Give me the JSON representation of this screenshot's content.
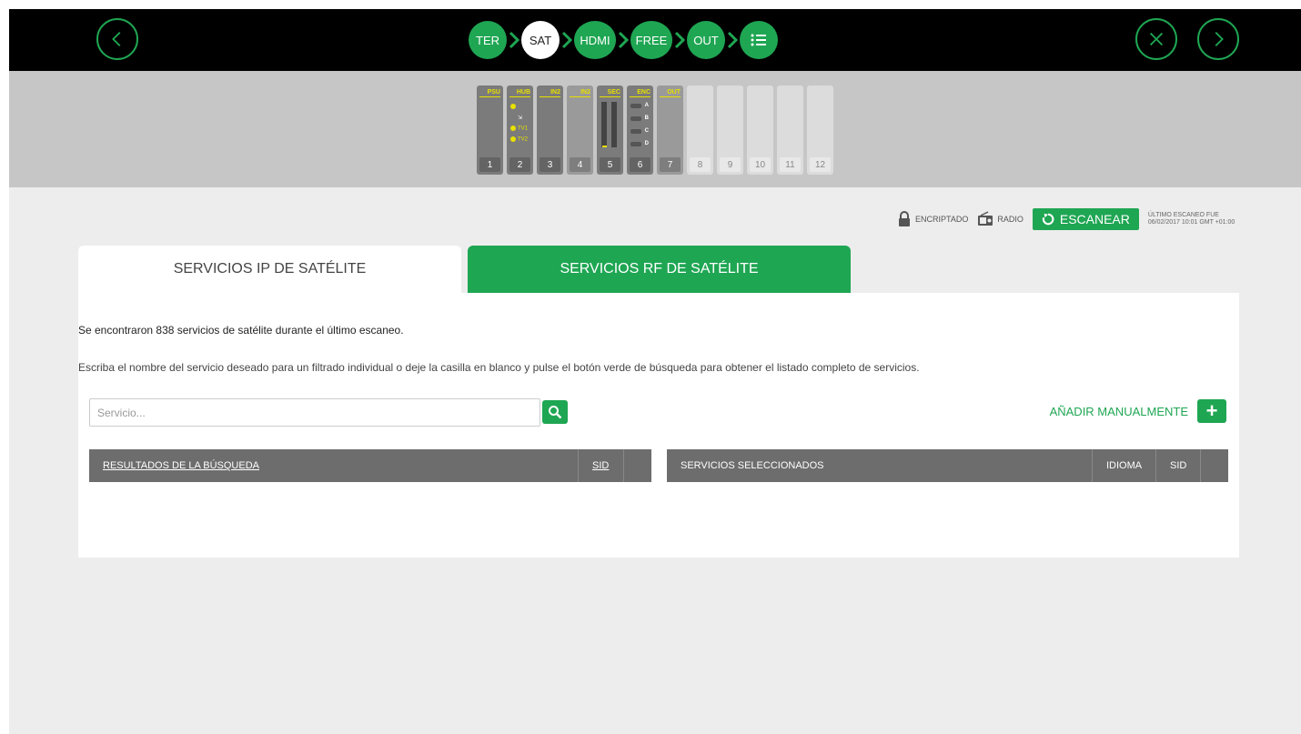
{
  "nav": {
    "steps": [
      "TER",
      "SAT",
      "HDMI",
      "FREE",
      "OUT"
    ],
    "active_step": "SAT"
  },
  "rack": {
    "slots": [
      {
        "num": "1",
        "label": "PSU"
      },
      {
        "num": "2",
        "label": "HUB",
        "ports": [
          "TV1",
          "TV2"
        ]
      },
      {
        "num": "3",
        "label": "IN2"
      },
      {
        "num": "4",
        "label": "IN2"
      },
      {
        "num": "5",
        "label": "SEC"
      },
      {
        "num": "6",
        "label": "ENC",
        "ports": [
          "A",
          "B",
          "C",
          "D"
        ]
      },
      {
        "num": "7",
        "label": "OUT"
      },
      {
        "num": "8",
        "label": ""
      },
      {
        "num": "9",
        "label": ""
      },
      {
        "num": "10",
        "label": ""
      },
      {
        "num": "11",
        "label": ""
      },
      {
        "num": "12",
        "label": ""
      }
    ]
  },
  "toolbar": {
    "encrypted_label": "ENCRIPTADO",
    "radio_label": "RADIO",
    "scan_label": "ESCANEAR",
    "last_scan_line1": "ÚLTIMO ESCANEO FUE",
    "last_scan_line2": "06/02/2017 10:01 GMT +01:00"
  },
  "tabs": {
    "ip": "SERVICIOS IP DE SATÉLITE",
    "rf": "SERVICIOS RF DE SATÉLITE"
  },
  "panel": {
    "found_text": "Se encontraron 838 servicios de satélite durante el último escaneo.",
    "instructions": "Escriba el nombre del servicio deseado para un filtrado individual o deje la casilla en blanco y pulse el botón verde de búsqueda para obtener el listado completo de servicios.",
    "search_placeholder": "Servicio...",
    "add_manual_label": "AÑADIR MANUALMENTE",
    "add_symbol": "+"
  },
  "results_table": {
    "col_name": "RESULTADOS DE LA BÚSQUEDA",
    "col_sid": "SID"
  },
  "selected_table": {
    "col_name": "SERVICIOS SELECCIONADOS",
    "col_lang": "IDIOMA",
    "col_sid": "SID"
  },
  "colors": {
    "accent": "#1fa653",
    "topbar": "#000000",
    "rackbar": "#c6c6c6",
    "table_header": "#6d6d6d"
  }
}
